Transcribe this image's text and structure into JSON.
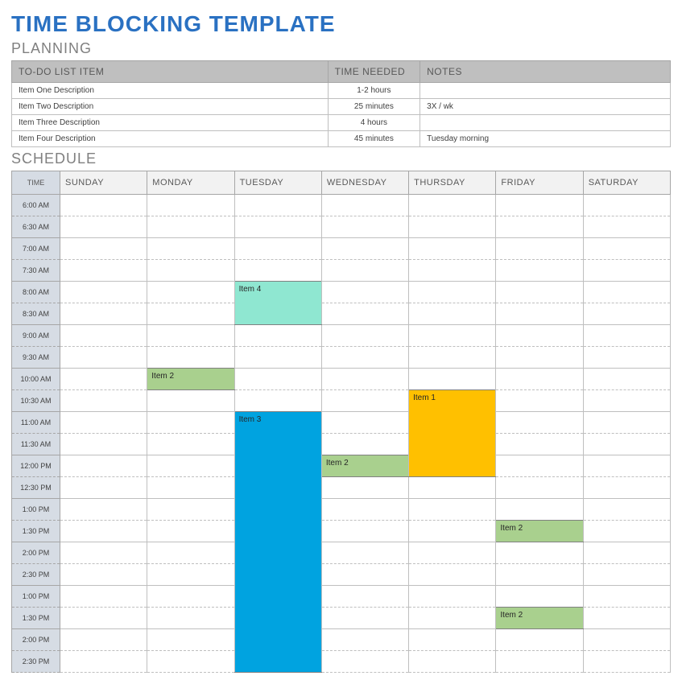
{
  "title": "TIME BLOCKING TEMPLATE",
  "planning": {
    "heading": "PLANNING",
    "columns": {
      "item": "TO-DO LIST ITEM",
      "time": "TIME NEEDED",
      "notes": "NOTES"
    },
    "rows": [
      {
        "item": "Item One Description",
        "time": "1-2 hours",
        "notes": ""
      },
      {
        "item": "Item Two Description",
        "time": "25 minutes",
        "notes": "3X / wk"
      },
      {
        "item": "Item Three Description",
        "time": "4 hours",
        "notes": ""
      },
      {
        "item": "Item Four Description",
        "time": "45 minutes",
        "notes": "Tuesday morning"
      }
    ]
  },
  "schedule": {
    "heading": "SCHEDULE",
    "time_header": "TIME",
    "days": [
      "SUNDAY",
      "MONDAY",
      "TUESDAY",
      "WEDNESDAY",
      "THURSDAY",
      "FRIDAY",
      "SATURDAY"
    ],
    "times": [
      "6:00 AM",
      "6:30 AM",
      "7:00 AM",
      "7:30 AM",
      "8:00 AM",
      "8:30 AM",
      "9:00 AM",
      "9:30 AM",
      "10:00 AM",
      "10:30 AM",
      "11:00 AM",
      "11:30 AM",
      "12:00 PM",
      "12:30 PM",
      "1:00 PM",
      "1:30 PM",
      "2:00 PM",
      "2:30 PM",
      "1:00 PM",
      "1:30 PM",
      "2:00 PM",
      "2:30 PM"
    ],
    "blocks": [
      {
        "row": 4,
        "col": 2,
        "span": 2,
        "label": "Item 4",
        "color": "teal"
      },
      {
        "row": 8,
        "col": 1,
        "span": 1,
        "label": "Item 2",
        "color": "green"
      },
      {
        "row": 9,
        "col": 4,
        "span": 4,
        "label": "Item 1",
        "color": "orange"
      },
      {
        "row": 10,
        "col": 2,
        "span": 12,
        "label": "Item 3",
        "color": "blue"
      },
      {
        "row": 12,
        "col": 3,
        "span": 1,
        "label": "Item 2",
        "color": "green"
      },
      {
        "row": 15,
        "col": 5,
        "span": 1,
        "label": "Item 2",
        "color": "green"
      },
      {
        "row": 19,
        "col": 5,
        "span": 1,
        "label": "Item 2",
        "color": "green"
      }
    ]
  }
}
